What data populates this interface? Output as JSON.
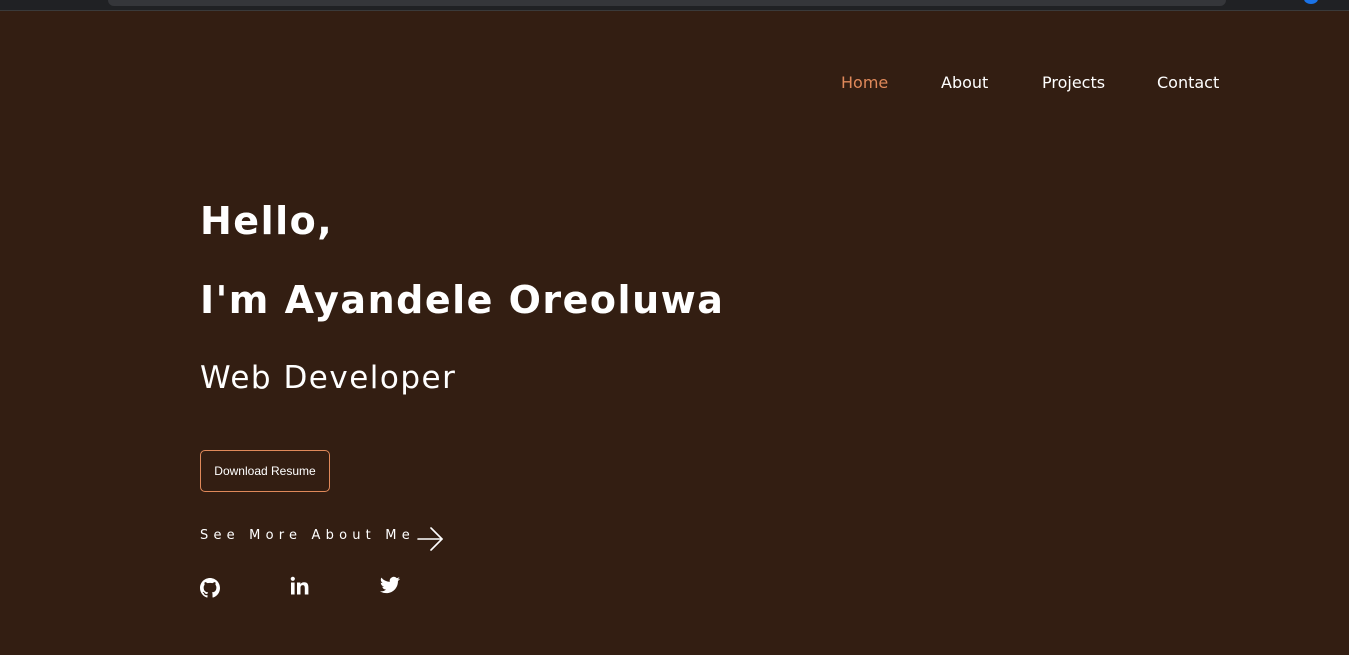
{
  "nav": {
    "items": [
      {
        "label": "Home",
        "active": true
      },
      {
        "label": "About",
        "active": false
      },
      {
        "label": "Projects",
        "active": false
      },
      {
        "label": "Contact",
        "active": false
      }
    ]
  },
  "hero": {
    "greeting": "Hello,",
    "name": "I'm Ayandele Oreoluwa",
    "role": "Web Developer",
    "resume_button": "Download Resume",
    "see_more": "See More About Me",
    "see_more_icon": "arrow-right-icon"
  },
  "socials": [
    {
      "icon": "github-icon"
    },
    {
      "icon": "linkedin-icon"
    },
    {
      "icon": "twitter-icon"
    }
  ],
  "colors": {
    "background": "#331e12",
    "accent": "#e0895a",
    "text": "#ffffff",
    "browser_chrome": "#202124"
  }
}
